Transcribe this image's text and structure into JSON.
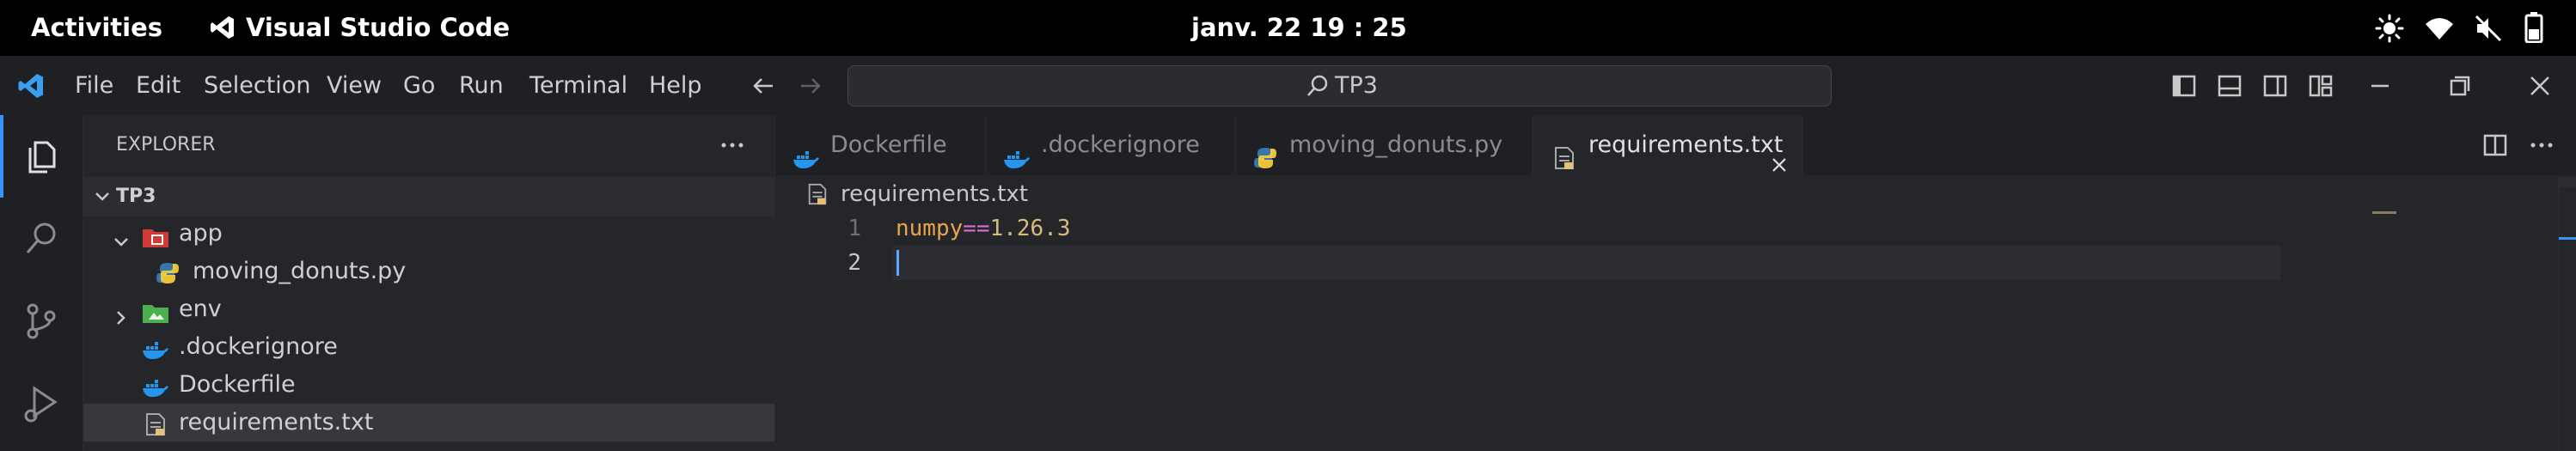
{
  "topbar": {
    "activities": "Activities",
    "app_name": "Visual Studio Code",
    "datetime": "janv. 22  19 : 25"
  },
  "menu": [
    "File",
    "Edit",
    "Selection",
    "View",
    "Go",
    "Run",
    "Terminal",
    "Help"
  ],
  "search": {
    "text": "TP3"
  },
  "explorer": {
    "title": "EXPLORER",
    "folder": "TP3",
    "items": [
      {
        "label": "app",
        "type": "folder",
        "icon": "folder-red-icon"
      },
      {
        "label": "moving_donuts.py",
        "type": "python",
        "icon": "python-icon"
      },
      {
        "label": "env",
        "type": "folder",
        "icon": "folder-green-icon"
      },
      {
        "label": ".dockerignore",
        "type": "docker",
        "icon": "docker-icon"
      },
      {
        "label": "Dockerfile",
        "type": "docker",
        "icon": "docker-icon"
      },
      {
        "label": "requirements.txt",
        "type": "text",
        "icon": "text-file-icon"
      }
    ]
  },
  "tabs": [
    {
      "label": "Dockerfile",
      "icon": "docker-icon"
    },
    {
      "label": ".dockerignore",
      "icon": "docker-icon"
    },
    {
      "label": "moving_donuts.py",
      "icon": "python-icon"
    },
    {
      "label": "requirements.txt",
      "icon": "text-file-icon",
      "active": true
    }
  ],
  "breadcrumb": "requirements.txt",
  "editor": {
    "lines": [
      {
        "number": "1",
        "name": "numpy",
        "op": "==",
        "version": "1.26.3"
      },
      {
        "number": "2"
      }
    ]
  },
  "colors": {
    "accent": "#3794ff",
    "docker": "#2496ed",
    "python_blue": "#3776ab",
    "python_yellow": "#ffd43b",
    "code_orange": "#e5a550",
    "code_op": "#d670d6",
    "code_number": "#d7ba7d"
  }
}
